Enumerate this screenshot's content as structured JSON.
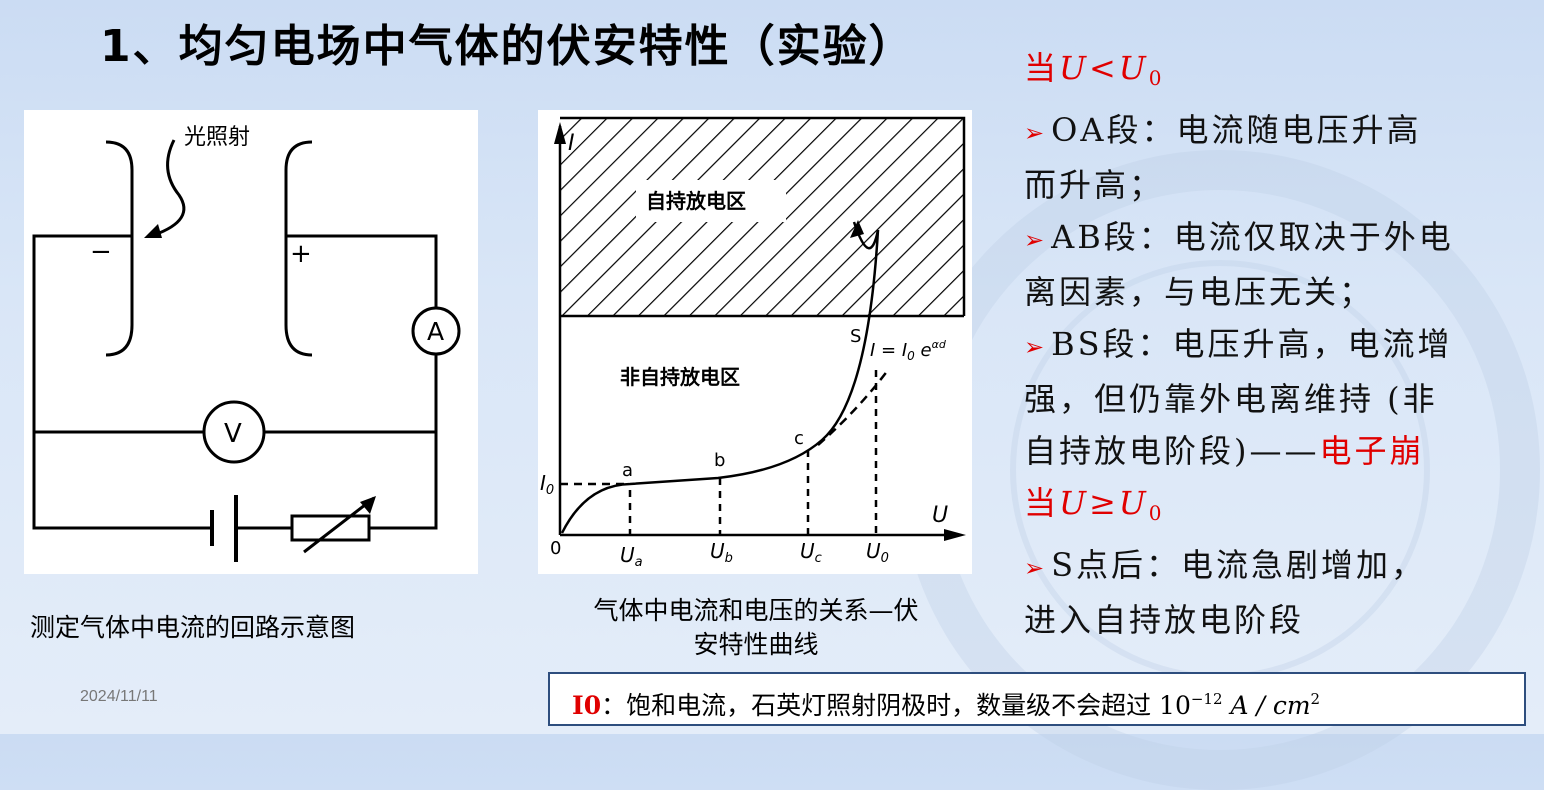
{
  "slide": {
    "title": "1、均匀电场中气体的伏安特性（实验）",
    "date": "2024/11/11"
  },
  "circuit": {
    "light_label": "光照射",
    "minus": "−",
    "plus": "+",
    "ammeter": "A",
    "voltmeter": "V",
    "caption": "测定气体中电流的回路示意图"
  },
  "graph": {
    "y_axis": "I",
    "x_axis": "U",
    "origin": "0",
    "i0": "I",
    "i0_sub": "0",
    "upper_region": "自持放电区",
    "lower_region": "非自持放电区",
    "point_a": "a",
    "point_b": "b",
    "point_c": "c",
    "point_s": "S",
    "formula": "I = I",
    "formula_sub": "0",
    "formula_tail": " e",
    "formula_sup": "αd",
    "ua": "U",
    "ua_sub": "a",
    "ub": "U",
    "ub_sub": "b",
    "uc": "U",
    "uc_sub": "c",
    "u0": "U",
    "u0_sub": "0",
    "caption_line1": "气体中电流和电压的关系—伏",
    "caption_line2": "安特性曲线"
  },
  "explanation": {
    "cond1_prefix": "当",
    "cond1_expr": "U<U",
    "cond1_sub": "0",
    "oa_line1": "OA段：电流随电压升高",
    "oa_line2": "而升高；",
    "ab_line1": "AB段：电流仅取决于外电",
    "ab_line2": "离因素，与电压无关；",
    "bs_line1": "BS段：电压升高，电流增",
    "bs_line2": "强，但仍靠外电离维持 (非",
    "bs_line3": "自持放电阶段)——",
    "bs_red": "电子崩",
    "cond2_prefix": "当",
    "cond2_expr": "U≥U",
    "cond2_sub": "0",
    "s_line1": "S点后：电流急剧增加，",
    "s_line2": "进入自持放电阶段",
    "arrow_glyph": "➢"
  },
  "note": {
    "label": "I0",
    "text": "：饱和电流，石英灯照射阴极时，数量级不会超过 10",
    "exp": "−12",
    "unit": " A / cm",
    "unit_exp": "2"
  },
  "colors": {
    "accent_red": "#e00000",
    "note_border": "#2e4e7e"
  }
}
